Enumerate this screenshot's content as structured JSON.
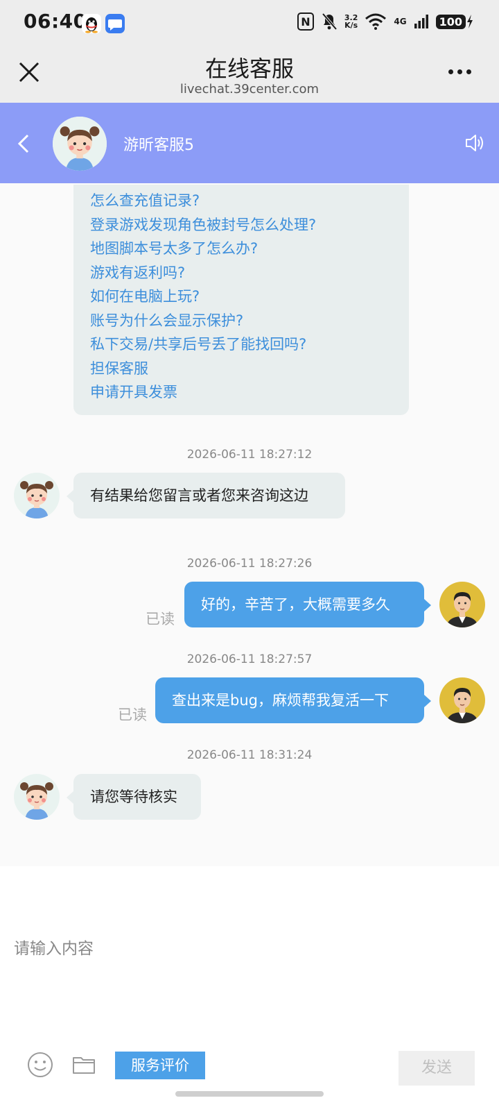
{
  "status_bar": {
    "time": "06:40",
    "net_speed_value": "3.2",
    "net_speed_unit": "K/s",
    "network_type": "4G",
    "battery": "100",
    "nfc_label": "N"
  },
  "browser": {
    "title": "在线客服",
    "url": "livechat.39center.com"
  },
  "chat_header": {
    "agent_name": "游昕客服5"
  },
  "faq": {
    "items": [
      "怎么查充值记录?",
      "登录游戏发现角色被封号怎么处理?",
      "地图脚本号太多了怎么办?",
      "游戏有返利吗?",
      "如何在电脑上玩?",
      "账号为什么会显示保护?",
      "私下交易/共享后号丢了能找回吗?",
      "担保客服",
      "申请开具发票"
    ]
  },
  "messages": [
    {
      "timestamp": "2026-06-11 18:27:12",
      "sender": "agent",
      "text": "有结果给您留言或者您来咨询这边"
    },
    {
      "timestamp": "2026-06-11 18:27:26",
      "sender": "user",
      "text": "好的，辛苦了，大概需要多久",
      "status": "已读"
    },
    {
      "timestamp": "2026-06-11 18:27:57",
      "sender": "user",
      "text": "查出来是bug，麻烦帮我复活一下",
      "status": "已读"
    },
    {
      "timestamp": "2026-06-11 18:31:24",
      "sender": "agent",
      "text": "请您等待核实"
    }
  ],
  "composer": {
    "placeholder": "请输入内容",
    "rating_label": "服务评价",
    "send_label": "发送"
  },
  "colors": {
    "header_bg": "#8c9cf7",
    "user_bubble": "#4da1e8",
    "agent_bubble": "#e8eeee",
    "link": "#3c8edb"
  }
}
